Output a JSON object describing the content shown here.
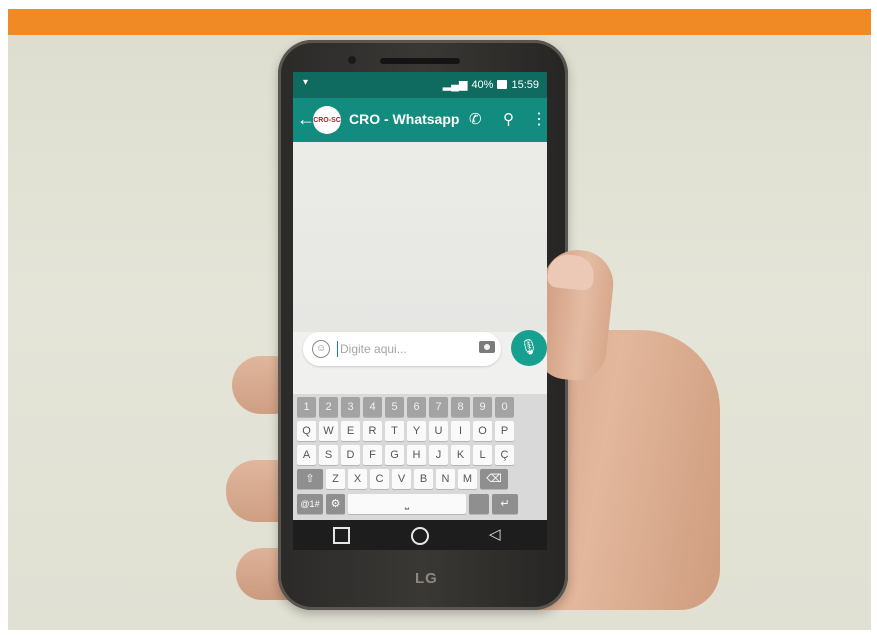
{
  "brand_color": "#f08a24",
  "status_bar": {
    "time": "15:59",
    "battery": "40%",
    "signal_icon": "signal-icon",
    "notification_icon": "notification-icon"
  },
  "chat_header": {
    "title": "CRO - Whatsapp",
    "avatar_text": "CRO-SC",
    "accent_color": "#128c7e",
    "icons": [
      "back-arrow-icon",
      "phone-call-icon",
      "paperclip-icon",
      "more-vert-icon"
    ]
  },
  "composer": {
    "placeholder": "Digite aqui...",
    "icons": [
      "emoji-icon",
      "camera-icon",
      "mic-icon"
    ]
  },
  "keyboard": {
    "number_row": [
      "1",
      "2",
      "3",
      "4",
      "5",
      "6",
      "7",
      "8",
      "9",
      "0"
    ],
    "row1": [
      "Q",
      "W",
      "E",
      "R",
      "T",
      "Y",
      "U",
      "I",
      "O",
      "P"
    ],
    "row2": [
      "A",
      "S",
      "D",
      "F",
      "G",
      "H",
      "J",
      "K",
      "L",
      "Ç"
    ],
    "row3": [
      "Z",
      "X",
      "C",
      "V",
      "B",
      "N",
      "M"
    ],
    "symbols_key": "@1#",
    "shift_icon": "shift-icon",
    "backspace_icon": "backspace-icon",
    "enter_icon": "enter-icon",
    "settings_icon": "settings-icon",
    "space_icon": "space-icon"
  },
  "nav_bar": {
    "icons": [
      "back-triangle-icon",
      "home-circle-icon",
      "recent-square-icon"
    ]
  },
  "device": {
    "logo": "LG"
  }
}
